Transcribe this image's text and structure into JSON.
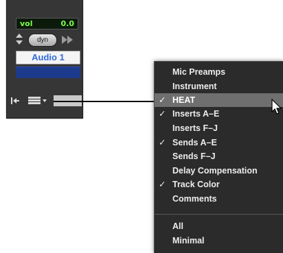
{
  "strip": {
    "volume_label": "vol",
    "volume_value": "0.0",
    "automation_mode": "dyn",
    "track_name": "Audio 1",
    "track_color": "#1d3b8c"
  },
  "menu": {
    "items": [
      {
        "label": "Mic Preamps",
        "check": ""
      },
      {
        "label": "Instrument",
        "check": ""
      },
      {
        "label": "HEAT",
        "check": "✓"
      },
      {
        "label": "Inserts A–E",
        "check": "✓"
      },
      {
        "label": "Inserts F–J",
        "check": ""
      },
      {
        "label": "Sends A–E",
        "check": "✓"
      },
      {
        "label": "Sends F–J",
        "check": ""
      },
      {
        "label": "Delay Compensation",
        "check": ""
      },
      {
        "label": "Track Color",
        "check": "✓"
      },
      {
        "label": "Comments",
        "check": ""
      },
      {
        "label": "All",
        "check": ""
      },
      {
        "label": "Minimal",
        "check": ""
      }
    ],
    "highlighted": "HEAT"
  },
  "icons": [
    "stepper-icon",
    "fast-forward-icon",
    "back-to-start-icon",
    "view-selector-icon",
    "pointer-cursor-icon"
  ],
  "colors": {
    "volume_text": "#7dff4a",
    "track_name_text": "#2f6bd8",
    "menu_bg": "#2b2b2b",
    "menu_highlight": "#6f6f6f"
  }
}
